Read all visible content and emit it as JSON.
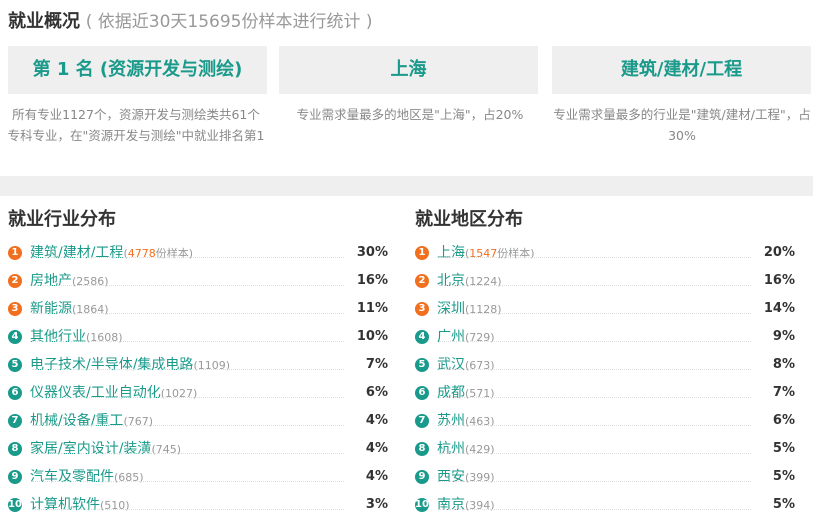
{
  "header": {
    "title": "就业概况",
    "subtitle": "( 依据近30天15695份样本进行统计 )"
  },
  "cards": [
    {
      "label": "第 1 名 (资源开发与测绘)",
      "desc": "所有专业1127个，资源开发与测绘类共61个专科专业，在\"资源开发与测绘\"中就业排名第1"
    },
    {
      "label": "上海",
      "desc": "专业需求量最多的地区是\"上海\"，占20%"
    },
    {
      "label": "建筑/建材/工程",
      "desc": "专业需求量最多的行业是\"建筑/建材/工程\"，占30%"
    }
  ],
  "industry": {
    "title": "就业行业分布",
    "first_suffix": "份样本",
    "items": [
      {
        "rank": "1",
        "name": "建筑/建材/工程",
        "count": "4778",
        "pct": "30%"
      },
      {
        "rank": "2",
        "name": "房地产",
        "count": "(2586)",
        "pct": "16%"
      },
      {
        "rank": "3",
        "name": "新能源",
        "count": "(1864)",
        "pct": "11%"
      },
      {
        "rank": "4",
        "name": "其他行业",
        "count": "(1608)",
        "pct": "10%"
      },
      {
        "rank": "5",
        "name": "电子技术/半导体/集成电路",
        "count": "(1109)",
        "pct": "7%"
      },
      {
        "rank": "6",
        "name": "仪器仪表/工业自动化",
        "count": "(1027)",
        "pct": "6%"
      },
      {
        "rank": "7",
        "name": "机械/设备/重工",
        "count": "(767)",
        "pct": "4%"
      },
      {
        "rank": "8",
        "name": "家居/室内设计/装潢",
        "count": "(745)",
        "pct": "4%"
      },
      {
        "rank": "9",
        "name": "汽车及零配件",
        "count": "(685)",
        "pct": "4%"
      },
      {
        "rank": "10",
        "name": "计算机软件",
        "count": "(510)",
        "pct": "3%"
      }
    ]
  },
  "region": {
    "title": "就业地区分布",
    "first_suffix": "份样本",
    "items": [
      {
        "rank": "1",
        "name": "上海",
        "count": "1547",
        "pct": "20%"
      },
      {
        "rank": "2",
        "name": "北京",
        "count": "(1224)",
        "pct": "16%"
      },
      {
        "rank": "3",
        "name": "深圳",
        "count": "(1128)",
        "pct": "14%"
      },
      {
        "rank": "4",
        "name": "广州",
        "count": "(729)",
        "pct": "9%"
      },
      {
        "rank": "5",
        "name": "武汉",
        "count": "(673)",
        "pct": "8%"
      },
      {
        "rank": "6",
        "name": "成都",
        "count": "(571)",
        "pct": "7%"
      },
      {
        "rank": "7",
        "name": "苏州",
        "count": "(463)",
        "pct": "6%"
      },
      {
        "rank": "8",
        "name": "杭州",
        "count": "(429)",
        "pct": "5%"
      },
      {
        "rank": "9",
        "name": "西安",
        "count": "(399)",
        "pct": "5%"
      },
      {
        "rank": "10",
        "name": "南京",
        "count": "(394)",
        "pct": "5%"
      }
    ]
  },
  "colors": {
    "accent": "#1a9a8a",
    "hot": "#f07020",
    "muted": "#999999",
    "panel": "#efefef"
  }
}
